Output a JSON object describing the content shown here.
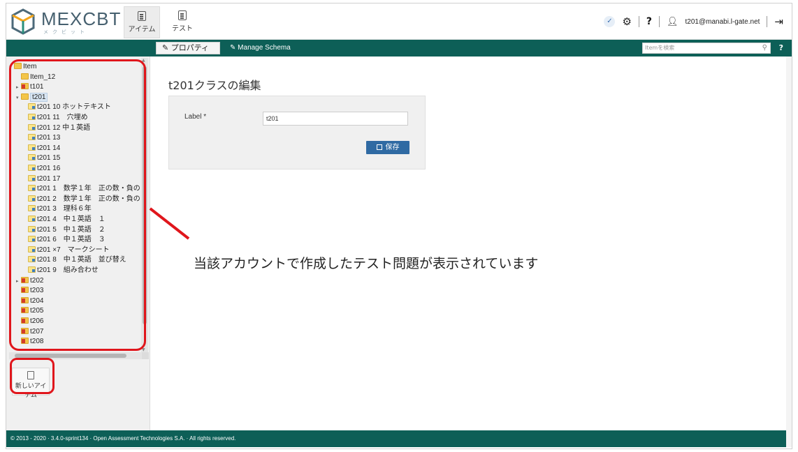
{
  "header": {
    "logo_text": "MEXCBT",
    "logo_sub": "メクビット",
    "tabs": [
      {
        "label": "アイテム",
        "active": true
      },
      {
        "label": "テスト",
        "active": false
      }
    ],
    "user_email": "t201@manabi.l-gate.net",
    "help": "?"
  },
  "actionbar": {
    "properties_label": "プロパティ",
    "manage_schema_label": "Manage Schema",
    "search_placeholder": "Itemを検索",
    "help": "?"
  },
  "tree": {
    "items": [
      {
        "label": "Item",
        "level": 0,
        "icon": "folder",
        "toggle": "▾"
      },
      {
        "label": "Item_12",
        "level": 1,
        "icon": "folder",
        "toggle": ""
      },
      {
        "label": "t101",
        "level": 1,
        "icon": "folder-red",
        "toggle": "▸"
      },
      {
        "label": "t201",
        "level": 1,
        "icon": "folder",
        "toggle": "▾",
        "selected": true
      },
      {
        "label": "t201 10 ホットテキスト",
        "level": 2,
        "icon": "doc",
        "toggle": ""
      },
      {
        "label": "t201 11　穴埋め",
        "level": 2,
        "icon": "doc",
        "toggle": ""
      },
      {
        "label": "t201 12 中１英語",
        "level": 2,
        "icon": "doc",
        "toggle": ""
      },
      {
        "label": "t201 13",
        "level": 2,
        "icon": "doc",
        "toggle": ""
      },
      {
        "label": "t201 14",
        "level": 2,
        "icon": "doc",
        "toggle": ""
      },
      {
        "label": "t201 15",
        "level": 2,
        "icon": "doc",
        "toggle": ""
      },
      {
        "label": "t201 16",
        "level": 2,
        "icon": "doc",
        "toggle": ""
      },
      {
        "label": "t201 17",
        "level": 2,
        "icon": "doc",
        "toggle": ""
      },
      {
        "label": "t201 1　数学１年　正の数・負の",
        "level": 2,
        "icon": "doc",
        "toggle": ""
      },
      {
        "label": "t201 2　数学１年　正の数・負の",
        "level": 2,
        "icon": "doc",
        "toggle": ""
      },
      {
        "label": "t201 3　理科６年",
        "level": 2,
        "icon": "doc",
        "toggle": ""
      },
      {
        "label": "t201 4　中１英語　１",
        "level": 2,
        "icon": "doc",
        "toggle": ""
      },
      {
        "label": "t201 5　中１英語　２",
        "level": 2,
        "icon": "doc",
        "toggle": ""
      },
      {
        "label": "t201 6　中１英語　３",
        "level": 2,
        "icon": "doc",
        "toggle": ""
      },
      {
        "label": "t201 ×7　マークシート",
        "level": 2,
        "icon": "doc",
        "toggle": ""
      },
      {
        "label": "t201 8　中１英語　並び替え",
        "level": 2,
        "icon": "doc",
        "toggle": ""
      },
      {
        "label": "t201 9　組み合わせ",
        "level": 2,
        "icon": "doc",
        "toggle": ""
      },
      {
        "label": "t202",
        "level": 1,
        "icon": "folder-red",
        "toggle": "▸"
      },
      {
        "label": "t203",
        "level": 1,
        "icon": "folder-red",
        "toggle": ""
      },
      {
        "label": "t204",
        "level": 1,
        "icon": "folder-red",
        "toggle": ""
      },
      {
        "label": "t205",
        "level": 1,
        "icon": "folder-red",
        "toggle": ""
      },
      {
        "label": "t206",
        "level": 1,
        "icon": "folder-red",
        "toggle": ""
      },
      {
        "label": "t207",
        "level": 1,
        "icon": "folder-red",
        "toggle": ""
      },
      {
        "label": "t208",
        "level": 1,
        "icon": "folder-red",
        "toggle": ""
      }
    ],
    "new_item_label": "新しいアイテム"
  },
  "main": {
    "title": "t201クラスの編集",
    "label_field_label": "Label *",
    "label_field_value": "t201",
    "save_label": "保存"
  },
  "annotation": {
    "text": "当該アカウントで作成したテスト問題が表示されています",
    "color": "#e0161c"
  },
  "footer": {
    "text": "© 2013 - 2020 · 3.4.0-sprint134 · Open Assessment Technologies S.A. · All rights reserved."
  },
  "colors": {
    "teal": "#0d5f57",
    "save_blue": "#2f6aa3"
  }
}
